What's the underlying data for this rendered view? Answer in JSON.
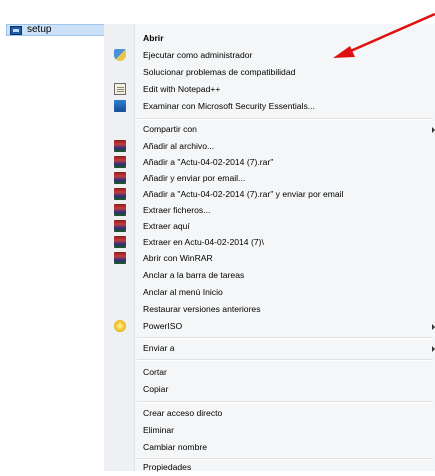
{
  "file": {
    "name": "setup"
  },
  "menu": {
    "items": [
      {
        "label": "Abrir",
        "bold": true,
        "icon": ""
      },
      {
        "label": "Ejecutar como administrador",
        "icon": "shield-icon"
      },
      {
        "label": "Solucionar problemas de compatibilidad",
        "icon": ""
      },
      {
        "label": "Edit with Notepad++",
        "icon": "notepad-icon"
      },
      {
        "label": "Examinar con Microsoft Security Essentials...",
        "icon": "security-essentials-icon"
      },
      {
        "label": "Compartir con",
        "icon": "",
        "submenu": true
      },
      {
        "label": "Añadir al archivo...",
        "icon": "winrar-icon"
      },
      {
        "label": "Añadir a \"Actu-04-02-2014 (7).rar\"",
        "icon": "winrar-icon"
      },
      {
        "label": "Añadir y enviar por email...",
        "icon": "winrar-icon"
      },
      {
        "label": "Añadir a \"Actu-04-02-2014 (7).rar\" y enviar por email",
        "icon": "winrar-icon"
      },
      {
        "label": "Extraer ficheros...",
        "icon": "winrar-icon"
      },
      {
        "label": "Extraer aquí",
        "icon": "winrar-icon"
      },
      {
        "label": "Extraer en Actu-04-02-2014 (7)\\",
        "icon": "winrar-icon"
      },
      {
        "label": "Abrir con WinRAR",
        "icon": "winrar-icon"
      },
      {
        "label": "Anclar a la barra de tareas",
        "icon": ""
      },
      {
        "label": "Anclar al menú Inicio",
        "icon": ""
      },
      {
        "label": "Restaurar versiones anteriores",
        "icon": ""
      },
      {
        "label": "PowerISO",
        "icon": "poweriso-icon",
        "submenu": true
      },
      {
        "label": "Enviar a",
        "icon": "",
        "submenu": true
      },
      {
        "label": "Cortar",
        "icon": ""
      },
      {
        "label": "Copiar",
        "icon": ""
      },
      {
        "label": "Crear acceso directo",
        "icon": ""
      },
      {
        "label": "Eliminar",
        "icon": ""
      },
      {
        "label": "Cambiar nombre",
        "icon": ""
      },
      {
        "label": "Propiedades",
        "icon": ""
      }
    ]
  },
  "colors": {
    "annotation_arrow": "#e01010",
    "selection": "#cce1f7"
  }
}
